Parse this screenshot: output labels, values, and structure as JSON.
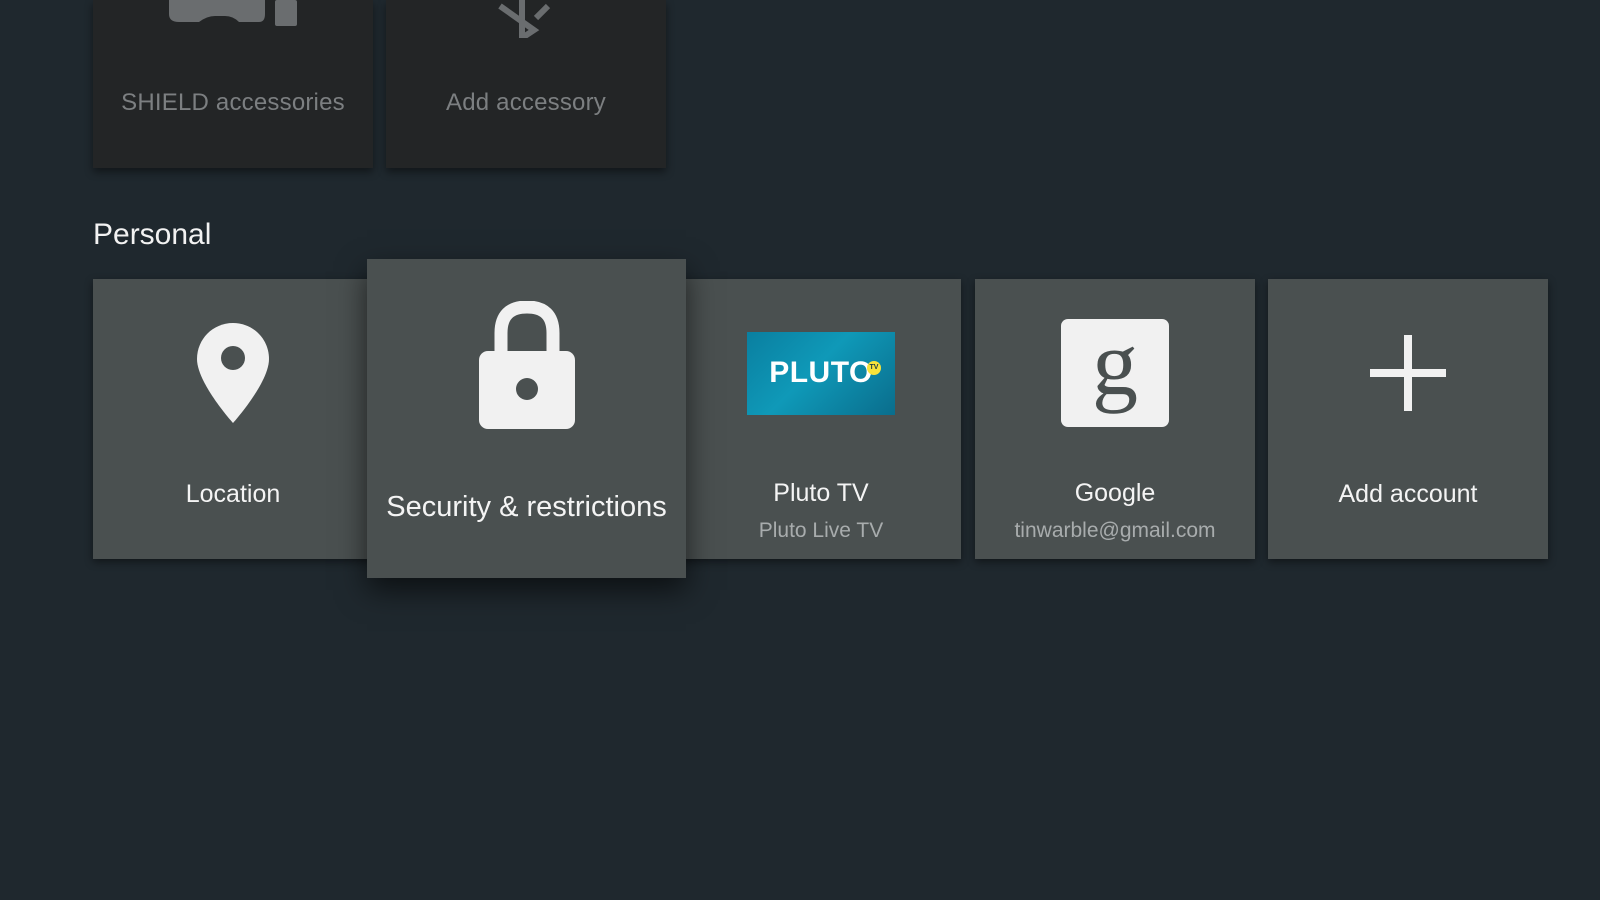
{
  "accessories": {
    "items": [
      {
        "label": "SHIELD accessories",
        "icon": "gamepad-icon"
      },
      {
        "label": "Add accessory",
        "icon": "bluetooth-icon"
      }
    ]
  },
  "personal": {
    "section_title": "Personal",
    "tiles": [
      {
        "title": "Location",
        "icon": "location-pin-icon"
      },
      {
        "title": "Security & restrictions",
        "icon": "lock-icon",
        "focused": true
      },
      {
        "title": "Pluto TV",
        "subtitle": "Pluto Live TV",
        "icon": "pluto-tv-logo",
        "logo_text": "PLUTO",
        "logo_badge": "TV"
      },
      {
        "title": "Google",
        "subtitle": "tinwarble@gmail.com",
        "icon": "google-g-icon"
      },
      {
        "title": "Add account",
        "icon": "plus-icon"
      }
    ]
  },
  "colors": {
    "background": "#1f282e",
    "tile": "#4a5050",
    "tile_dim": "#232526",
    "pluto_blue": "#0f99b8",
    "pluto_badge": "#f7e33a"
  }
}
